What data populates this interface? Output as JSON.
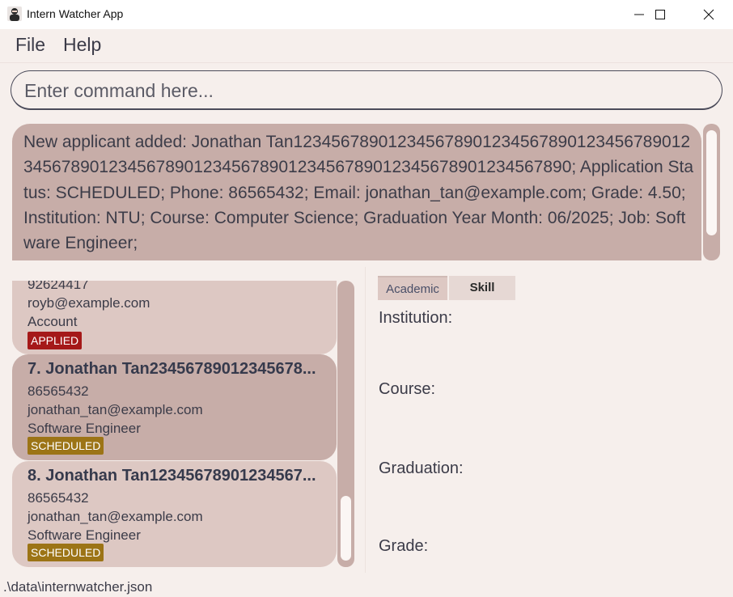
{
  "window": {
    "title": "Intern Watcher App",
    "icon": "app-logo-icon",
    "controls": [
      "minimize-icon",
      "maximize-icon",
      "close-icon"
    ]
  },
  "menu": {
    "file": "File",
    "help": "Help"
  },
  "command": {
    "placeholder": "Enter command here...",
    "value": ""
  },
  "result": {
    "text": "New applicant added: Jonathan Tan1234567890123456789012345678901234567890123456789012345678901234567890123456789012345678901234567890; Application Status: SCHEDULED; Phone: 86565432; Email: jonathan_tan@example.com; Grade: 4.50; Institution: NTU; Course: Computer Science; Graduation Year Month: 06/2025; Job: Software Engineer;"
  },
  "applicants": [
    {
      "title": "",
      "phone": "92624417",
      "email": "royb@example.com",
      "job": "Account",
      "status": "APPLIED"
    },
    {
      "title": "7.  Jonathan Tan23456789012345678...",
      "phone": "86565432",
      "email": "jonathan_tan@example.com",
      "job": "Software Engineer",
      "status": "SCHEDULED"
    },
    {
      "title": "8.  Jonathan Tan12345678901234567...",
      "phone": "86565432",
      "email": "jonathan_tan@example.com",
      "job": "Software Engineer",
      "status": "SCHEDULED"
    }
  ],
  "detail": {
    "tabs": {
      "academic": "Academic",
      "skill": "Skill"
    },
    "labels": {
      "institution": "Institution:",
      "course": "Course:",
      "graduation": "Graduation:",
      "grade": "Grade:"
    }
  },
  "status_bar": {
    "path": ".\\data\\internwatcher.json"
  },
  "colors": {
    "background": "#f6efec",
    "card": "#ddc8c3",
    "card_selected": "#c7ada8",
    "applied": "#a51919",
    "scheduled": "#9c7416"
  }
}
